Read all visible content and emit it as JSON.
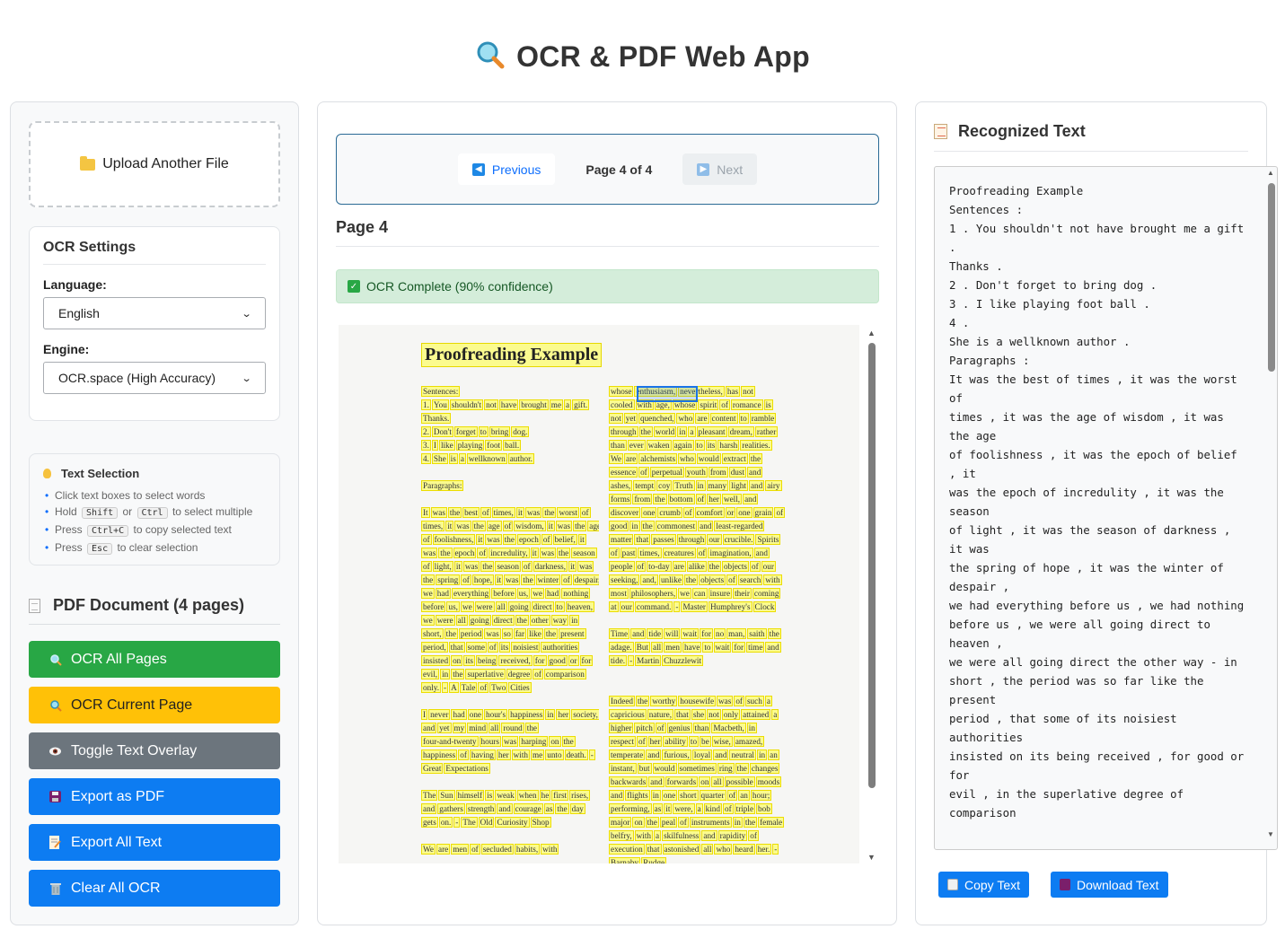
{
  "app": {
    "title": "OCR & PDF Web App",
    "title_icon": "magnifier-icon",
    "accent": "#0d7cf2"
  },
  "left": {
    "upload_label": "Upload Another File",
    "ocr_settings": {
      "title": "OCR Settings",
      "language_label": "Language:",
      "language_value": "English",
      "engine_label": "Engine:",
      "engine_value": "OCR.space (High Accuracy)"
    },
    "text_selection": {
      "title": "Text Selection",
      "tip1": "Click text boxes to select words",
      "tip2_a": "Hold",
      "tip2_k1": "Shift",
      "tip2_b": "or",
      "tip2_k2": "Ctrl",
      "tip2_c": "to select multiple",
      "tip3_a": "Press",
      "tip3_k": "Ctrl+C",
      "tip3_b": "to copy selected text",
      "tip4_a": "Press",
      "tip4_k": "Esc",
      "tip4_b": "to clear selection"
    },
    "pdf_title": "PDF Document (4 pages)",
    "buttons": {
      "ocr_all": "OCR All Pages",
      "ocr_current": "OCR Current Page",
      "toggle_overlay": "Toggle Text Overlay",
      "export_pdf": "Export as PDF",
      "export_text": "Export All Text",
      "clear_ocr": "Clear All OCR"
    },
    "colors": {
      "green": "#28a745",
      "yellow": "#ffc107",
      "gray": "#6c757d",
      "blue": "#0d7cf2"
    }
  },
  "center": {
    "prev_label": "Previous",
    "next_label": "Next",
    "page_info": "Page 4 of 4",
    "page_heading": "Page 4",
    "status": "OCR Complete (90% confidence)",
    "doc": {
      "title": "Proofreading Example",
      "col1": [
        [
          "Sentences:"
        ],
        [
          "1. You shouldn't not have brought me a gift."
        ],
        [
          "Thanks."
        ],
        [
          "2. Don't forget to bring dog."
        ],
        [
          "3. I like playing foot ball."
        ],
        [
          "4. She is a wellknown author."
        ],
        [
          ""
        ],
        [
          "Paragraphs:"
        ],
        [
          ""
        ],
        [
          "It was the best of times, it was the worst of"
        ],
        [
          "times, it was the age of wisdom, it was the age"
        ],
        [
          "of foolishness, it was the epoch of belief, it"
        ],
        [
          "was the epoch of incredulity, it was the season"
        ],
        [
          "of light, it was the season of darkness, it was"
        ],
        [
          "the spring of hope, it was the winter of despair,"
        ],
        [
          "we had everything before us, we had nothing"
        ],
        [
          "before us, we were all going direct to heaven,"
        ],
        [
          "we were all going direct the other way in"
        ],
        [
          "short, the period was so far like the present"
        ],
        [
          "period, that some of its noisiest authorities"
        ],
        [
          "insisted on its being received, for good or for"
        ],
        [
          "evil, in the superlative degree of comparison"
        ],
        [
          "only. - A Tale of Two Cities"
        ],
        [
          ""
        ],
        [
          "I never had one hour's happiness in her society,"
        ],
        [
          "and yet my mind all round the"
        ],
        [
          "four-and-twenty hours was harping on the"
        ],
        [
          "happiness of having her with me unto death. -"
        ],
        [
          "Great Expectations"
        ],
        [
          ""
        ],
        [
          "The Sun himself is weak when he first rises,"
        ],
        [
          "and gathers strength and courage as the day"
        ],
        [
          "gets on. - The Old Curiosity Shop"
        ],
        [
          ""
        ],
        [
          "We are men of secluded habits, with"
        ]
      ],
      "col2": [
        [
          "whose enthusiasm, nevertheless, has not"
        ],
        [
          "cooled with age, whose spirit of romance is"
        ],
        [
          "not yet quenched, who are content to ramble"
        ],
        [
          "through the world in a pleasant dream, rather"
        ],
        [
          "than ever waken again to its harsh realities."
        ],
        [
          "We are alchemists who would extract the"
        ],
        [
          "essence of perpetual youth from dust and"
        ],
        [
          "ashes, tempt coy Truth in many light and airy"
        ],
        [
          "forms from the bottom of her well, and"
        ],
        [
          "discover one crumb of comfort or one grain of"
        ],
        [
          "good in the commonest and least-regarded"
        ],
        [
          "matter that passes through our crucible. Spirits"
        ],
        [
          "of past times, creatures of imagination, and"
        ],
        [
          "people of to-day are alike the objects of our"
        ],
        [
          "seeking, and, unlike the objects of search with"
        ],
        [
          "most philosophers, we can insure their coming"
        ],
        [
          "at our command. - Master Humphrey's Clock"
        ],
        [
          ""
        ],
        [
          "Time and tide will wait for no man, saith the"
        ],
        [
          "adage. But all men have to wait for time and"
        ],
        [
          "tide. - Martin Chuzzlewit"
        ],
        [
          ""
        ],
        [
          ""
        ],
        [
          "Indeed the worthy housewife was of such a"
        ],
        [
          "capricious nature, that she not only attained a"
        ],
        [
          "higher pitch of genius than Macbeth, in"
        ],
        [
          "respect of her ability to be wise, amazed,"
        ],
        [
          "temperate and furious, loyal and neutral in an"
        ],
        [
          "instant, but would sometimes ring the changes"
        ],
        [
          "backwards and forwards on all possible moods"
        ],
        [
          "and flights in one short quarter of an hour;"
        ],
        [
          "performing, as it were, a kind of triple bob"
        ],
        [
          "major on the peal of instruments in the female"
        ],
        [
          "belfry, with a skilfulness and rapidity of"
        ],
        [
          "execution that astonished all who heard her. -"
        ],
        [
          "Barnaby Rudge"
        ]
      ]
    }
  },
  "right": {
    "title": "Recognized Text",
    "text": "Proofreading Example\nSentences :\n1 . You shouldn't not have brought me a gift .\nThanks .\n2 . Don't forget to bring dog .\n3 . I like playing foot ball .\n4 .\nShe is a wellknown author .\nParagraphs :\nIt was the best of times , it was the worst of\ntimes , it was the age of wisdom , it was the age\nof foolishness , it was the epoch of belief , it\nwas the epoch of incredulity , it was the season\nof light , it was the season of darkness , it was\nthe spring of hope , it was the winter of despair ,\nwe had everything before us , we had nothing\nbefore us , we were all going direct to heaven ,\nwe were all going direct the other way - in\nshort , the period was so far like the present\nperiod , that some of its noisiest authorities\ninsisted on its being received , for good or for\nevil , in the superlative degree of comparison",
    "copy_label": "Copy Text",
    "download_label": "Download Text"
  }
}
